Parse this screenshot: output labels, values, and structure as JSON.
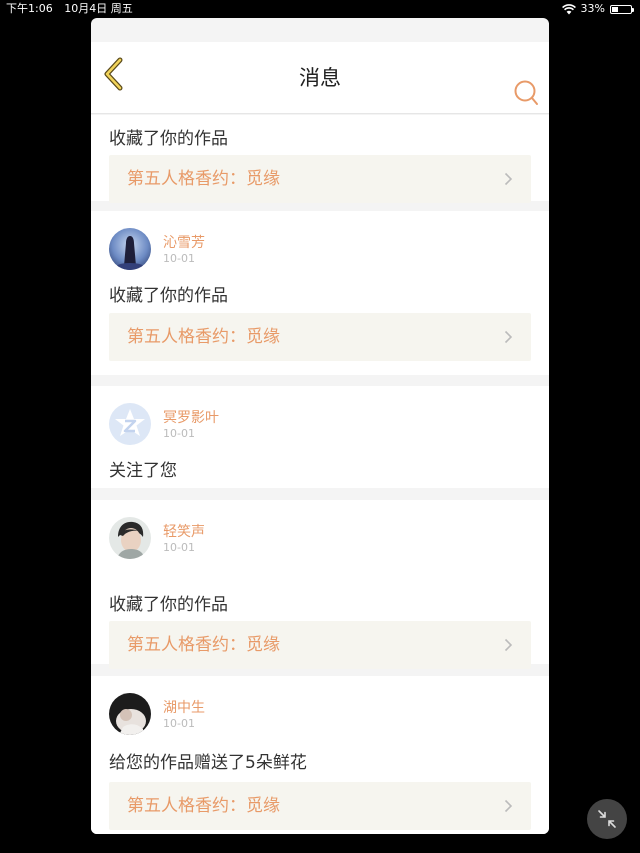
{
  "status_bar": {
    "time": "下午1:06",
    "date": "10月4日 周五",
    "battery": "33%",
    "battery_level": 0.33,
    "wifi_icon": "wifi-icon"
  },
  "nav": {
    "title": "消息",
    "back_icon": "chevron-left-icon",
    "search_icon": "search-icon",
    "accent_color": "#e89a68"
  },
  "messages": [
    {
      "action": "收藏了你的作品",
      "work": "第五人格香约：觅缘"
    },
    {
      "user": "沁雪芳",
      "date": "10-01",
      "action": "收藏了你的作品",
      "work": "第五人格香约：觅缘"
    },
    {
      "user": "冥罗影叶",
      "date": "10-01",
      "action": "关注了您"
    },
    {
      "user": "轻笑声",
      "date": "10-01",
      "action": "收藏了你的作品",
      "work": "第五人格香约：觅缘"
    },
    {
      "user": "湖中生",
      "date": "10-01",
      "action": "给您的作品赠送了5朵鲜花",
      "work": "第五人格香约：觅缘"
    }
  ],
  "floating": {
    "collapse_icon": "collapse-icon"
  }
}
